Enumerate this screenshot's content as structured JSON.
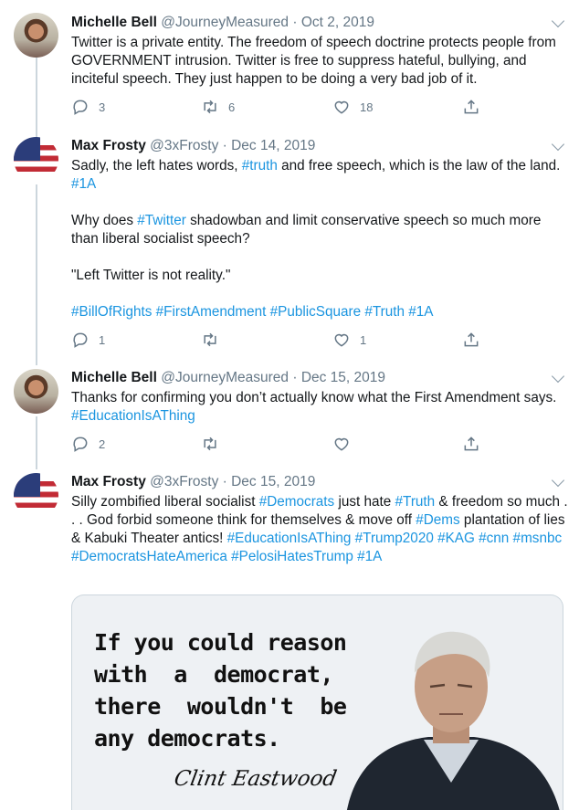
{
  "tweets": [
    {
      "name": "Michelle Bell",
      "handle": "@JourneyMeasured",
      "sep": " · ",
      "date": "Oct 2, 2019",
      "body": [
        [
          {
            "t": "Twitter is a private entity. The freedom of speech doctrine protects people from GOVERNMENT intrusion. Twitter is free to suppress hateful, bullying, and inciteful speech. They just happen to be doing a very bad job of it."
          }
        ]
      ],
      "reply_count": "3",
      "retweet_count": "6",
      "like_count": "18"
    },
    {
      "name": "Max Frosty",
      "handle": "@3xFrosty",
      "sep": " · ",
      "date": "Dec 14, 2019",
      "body": [
        [
          {
            "t": "Sadly, the left hates words, "
          },
          {
            "t": "#truth",
            "tag": true
          },
          {
            "t": " and free speech, which is the law of the land. "
          },
          {
            "t": "#1A",
            "tag": true
          }
        ],
        [
          {
            "t": "Why does "
          },
          {
            "t": "#Twitter",
            "tag": true
          },
          {
            "t": " shadowban and limit conservative speech so much more than liberal socialist speech?"
          }
        ],
        [
          {
            "t": "\"Left Twitter is not reality.\""
          }
        ],
        [
          {
            "t": "#BillOfRights #FirstAmendment #PublicSquare #Truth #1A",
            "tag": true
          }
        ]
      ],
      "reply_count": "1",
      "retweet_count": "",
      "like_count": "1"
    },
    {
      "name": "Michelle Bell",
      "handle": "@JourneyMeasured",
      "sep": " · ",
      "date": "Dec 15, 2019",
      "body": [
        [
          {
            "t": "Thanks for confirming you don’t actually know what the First Amendment says. "
          },
          {
            "t": "#EducationIsAThing",
            "tag": true
          }
        ]
      ],
      "reply_count": "2",
      "retweet_count": "",
      "like_count": ""
    },
    {
      "name": "Max Frosty",
      "handle": "@3xFrosty",
      "sep": " · ",
      "date": "Dec 15, 2019",
      "body": [
        [
          {
            "t": "Silly zombified liberal socialist "
          },
          {
            "t": "#Democrats",
            "tag": true
          },
          {
            "t": " just hate "
          },
          {
            "t": "#Truth",
            "tag": true
          },
          {
            "t": " & freedom so much . . . God forbid someone think for themselves & move off "
          },
          {
            "t": "#Dems",
            "tag": true
          },
          {
            "t": " plantation of lies & Kabuki Theater antics! "
          },
          {
            "t": "#EducationIsAThing #Trump2020 #KAG #cnn #msnbc #DemocratsHateAmerica #PelosiHatesTrump #1A",
            "tag": true
          }
        ]
      ]
    }
  ],
  "media": {
    "quote_lines": "If you could reason\nwith  a  democrat,\nthere  wouldn't  be\nany democrats.",
    "signature": "Clint Eastwood"
  },
  "icons": {
    "reply": "reply-icon",
    "retweet": "retweet-icon",
    "like": "heart-icon",
    "share": "share-icon",
    "more": "chevron-down-icon"
  },
  "colors": {
    "link": "#1b95e0",
    "muted": "#657786",
    "thread_line": "#ccd6dd"
  }
}
